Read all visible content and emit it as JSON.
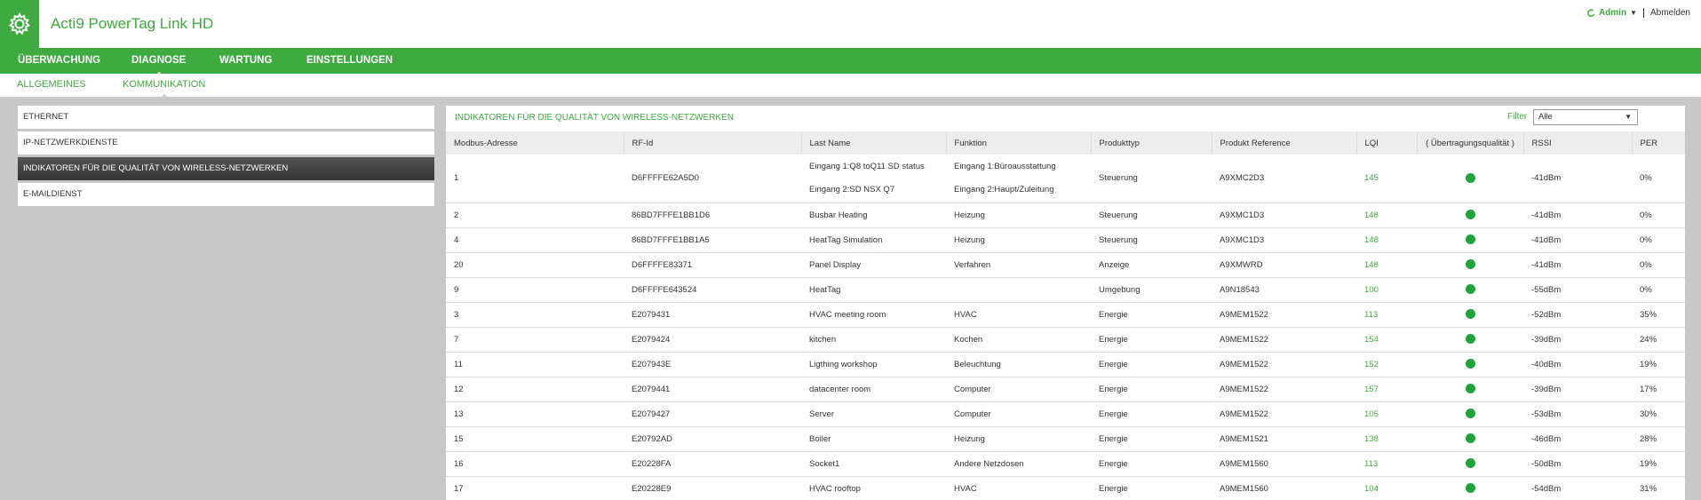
{
  "header": {
    "app_title": "Acti9 PowerTag Link HD",
    "user": "Admin",
    "logout": "Abmelden",
    "brand_color": "#3dab3f"
  },
  "main_nav": {
    "tabs": [
      {
        "label": "ÜBERWACHUNG",
        "active": false
      },
      {
        "label": "DIAGNOSE",
        "active": true
      },
      {
        "label": "WARTUNG",
        "active": false
      },
      {
        "label": "EINSTELLUNGEN",
        "active": false
      }
    ]
  },
  "sub_nav": {
    "tabs": [
      {
        "label": "ALLGEMEINES",
        "active": false
      },
      {
        "label": "KOMMUNIKATION",
        "active": true
      }
    ]
  },
  "left_menu": {
    "items": [
      {
        "label": "ETHERNET",
        "selected": false
      },
      {
        "label": "IP-NETZWERKDIENSTE",
        "selected": false
      },
      {
        "label": "INDIKATOREN FÜR DIE QUALITÄT VON WIRELESS-NETZWERKEN",
        "selected": true
      },
      {
        "label": "E-MAILDIENST",
        "selected": false
      }
    ]
  },
  "content": {
    "title": "INDIKATOREN FÜR DIE QUALITÄT VON WIRELESS-NETZWERKEN",
    "filter_label": "Filter",
    "filter_value": "Alle",
    "status_color": "#1fa33a"
  },
  "table": {
    "columns": [
      "Modbus-Adresse",
      "RF-Id",
      "Last Name",
      "Funktion",
      "Produkttyp",
      "Produkt Reference",
      "LQI",
      "( Übertragungsqualität )",
      "RSSI",
      "PER"
    ],
    "rows": [
      {
        "modbus": "1",
        "rfid": "D6FFFFE62A5D0",
        "last_name": [
          "Eingang 1:Q8 toQ11 SD status",
          "Eingang 2:SD NSX Q7"
        ],
        "funktion": [
          "Eingang 1:Büroausstattung",
          "Eingang 2:Haupt/Zuleitung"
        ],
        "produkttyp": "Steuerung",
        "reference": "A9XMC2D3",
        "lqi": "145",
        "rssi": "-41dBm",
        "per": "0%"
      },
      {
        "modbus": "2",
        "rfid": "86BD7FFFE1BB1D6",
        "last_name": "Busbar Heating",
        "funktion": "Heizung",
        "produkttyp": "Steuerung",
        "reference": "A9XMC1D3",
        "lqi": "148",
        "rssi": "-41dBm",
        "per": "0%"
      },
      {
        "modbus": "4",
        "rfid": "86BD7FFFE1BB1A5",
        "last_name": "HeatTag Simulation",
        "funktion": "Heizung",
        "produkttyp": "Steuerung",
        "reference": "A9XMC1D3",
        "lqi": "148",
        "rssi": "-41dBm",
        "per": "0%"
      },
      {
        "modbus": "20",
        "rfid": "D6FFFFE83371",
        "last_name": "Panel Display",
        "funktion": "Verfahren",
        "produkttyp": "Anzeige",
        "reference": "A9XMWRD",
        "lqi": "148",
        "rssi": "-41dBm",
        "per": "0%"
      },
      {
        "modbus": "9",
        "rfid": "D6FFFFE643524",
        "last_name": "HeatTag",
        "funktion": "",
        "produkttyp": "Umgebung",
        "reference": "A9N18543",
        "lqi": "100",
        "rssi": "-55dBm",
        "per": "0%"
      },
      {
        "modbus": "3",
        "rfid": "E2079431",
        "last_name": "HVAC meeting room",
        "funktion": "HVAC",
        "produkttyp": "Energie",
        "reference": "A9MEM1522",
        "lqi": "113",
        "rssi": "-52dBm",
        "per": "35%"
      },
      {
        "modbus": "7",
        "rfid": "E2079424",
        "last_name": "kitchen",
        "funktion": "Kochen",
        "produkttyp": "Energie",
        "reference": "A9MEM1522",
        "lqi": "154",
        "rssi": "-39dBm",
        "per": "24%"
      },
      {
        "modbus": "11",
        "rfid": "E207943E",
        "last_name": "Ligthing workshop",
        "funktion": "Beleuchtung",
        "produkttyp": "Energie",
        "reference": "A9MEM1522",
        "lqi": "152",
        "rssi": "-40dBm",
        "per": "19%"
      },
      {
        "modbus": "12",
        "rfid": "E2079441",
        "last_name": "datacenter room",
        "funktion": "Computer",
        "produkttyp": "Energie",
        "reference": "A9MEM1522",
        "lqi": "157",
        "rssi": "-39dBm",
        "per": "17%"
      },
      {
        "modbus": "13",
        "rfid": "E2079427",
        "last_name": "Server",
        "funktion": "Computer",
        "produkttyp": "Energie",
        "reference": "A9MEM1522",
        "lqi": "105",
        "rssi": "-53dBm",
        "per": "30%"
      },
      {
        "modbus": "15",
        "rfid": "E20792AD",
        "last_name": "Boiler",
        "funktion": "Heizung",
        "produkttyp": "Energie",
        "reference": "A9MEM1521",
        "lqi": "138",
        "rssi": "-46dBm",
        "per": "28%"
      },
      {
        "modbus": "16",
        "rfid": "E20228FA",
        "last_name": "Socket1",
        "funktion": "Andere Netzdosen",
        "produkttyp": "Energie",
        "reference": "A9MEM1560",
        "lqi": "113",
        "rssi": "-50dBm",
        "per": "19%"
      },
      {
        "modbus": "17",
        "rfid": "E20228E9",
        "last_name": "HVAC rooftop",
        "funktion": "HVAC",
        "produkttyp": "Energie",
        "reference": "A9MEM1560",
        "lqi": "104",
        "rssi": "-54dBm",
        "per": "31%"
      }
    ]
  }
}
